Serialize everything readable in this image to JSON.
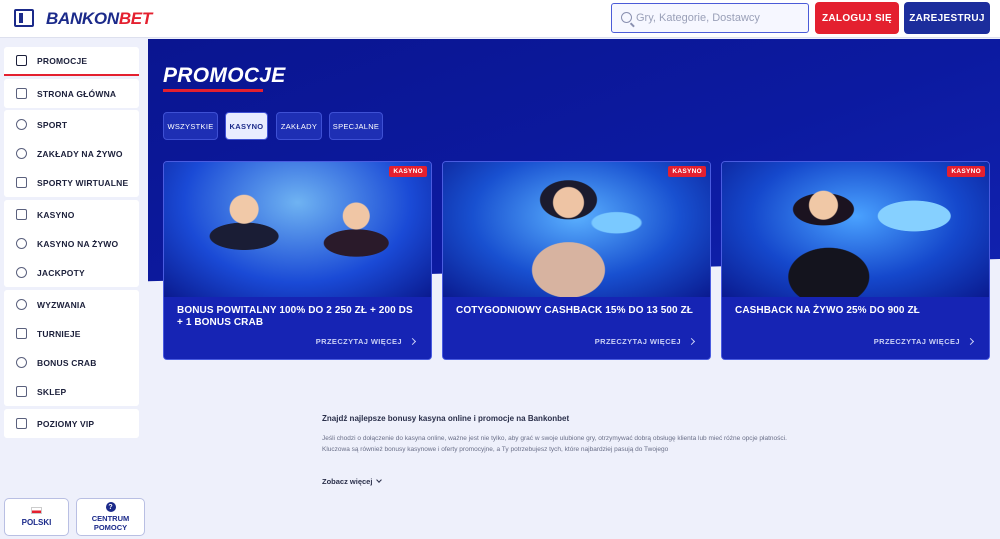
{
  "header": {
    "logo_left": "BANKON",
    "logo_right": "BET",
    "search_placeholder": "Gry, Kategorie, Dostawcy",
    "login_label": "ZALOGUJ SIĘ",
    "register_label": "ZAREJESTRUJ"
  },
  "sidebar": {
    "items": [
      {
        "label": "PROMOCJE",
        "icon": "gift-icon"
      },
      {
        "label": "STRONA GŁÓWNA",
        "icon": "home-icon"
      },
      {
        "label": "SPORT",
        "icon": "soccer-ball-icon"
      },
      {
        "label": "ZAKŁADY NA ŻYWO",
        "icon": "live-signal-icon"
      },
      {
        "label": "SPORTY WIRTUALNE",
        "icon": "virtual-sports-icon"
      },
      {
        "label": "KASYNO",
        "icon": "cards-icon"
      },
      {
        "label": "KASYNO NA ŻYWO",
        "icon": "live-casino-icon"
      },
      {
        "label": "JACKPOTY",
        "icon": "jackpot-icon"
      },
      {
        "label": "WYZWANIA",
        "icon": "medal-icon"
      },
      {
        "label": "TURNIEJE",
        "icon": "trophy-icon"
      },
      {
        "label": "BONUS CRAB",
        "icon": "crab-icon"
      },
      {
        "label": "SKLEP",
        "icon": "shop-bag-icon"
      },
      {
        "label": "POZIOMY VIP",
        "icon": "diamond-icon"
      }
    ],
    "language_label": "POLSKI",
    "help_label_line1": "CENTRUM",
    "help_label_line2": "POMOCY",
    "help_icon_glyph": "?"
  },
  "main": {
    "title": "PROMOCJE",
    "filters": [
      "WSZYSTKIE",
      "KASYNO",
      "ZAKŁADY",
      "SPECJALNE"
    ],
    "active_filter": "KASYNO",
    "cards": [
      {
        "badge": "KASYNO",
        "title": "BONUS POWITALNY 100% DO 2 250 ZŁ + 200 DS + 1 BONUS CRAB",
        "cta": "PRZECZYTAJ WIĘCEJ"
      },
      {
        "badge": "KASYNO",
        "title": "COTYGODNIOWY CASHBACK 15% DO 13 500 ZŁ",
        "cta": "PRZECZYTAJ WIĘCEJ"
      },
      {
        "badge": "KASYNO",
        "title": "CASHBACK NA ŻYWO 25% DO 900 ZŁ",
        "cta": "PRZECZYTAJ WIĘCEJ"
      }
    ],
    "seo_title": "Znajdź najlepsze bonusy kasyna online i promocje na Bankonbet",
    "seo_text": "Jeśli chodzi o dołączenie do kasyna online, ważne jest nie tylko, aby grać w swoje ulubione gry, otrzymywać dobrą obsługę klienta lub mieć różne opcje płatności. Kluczowa są również bonusy kasynowe i oferty promocyjne, a Ty potrzebujesz tych, które najbardziej pasują do Twojego",
    "see_more_label": "Zobacz więcej"
  },
  "colors": {
    "brand_blue": "#1b2a8a",
    "brand_red": "#e4202f",
    "hero_blue": "#0c1aa0"
  }
}
